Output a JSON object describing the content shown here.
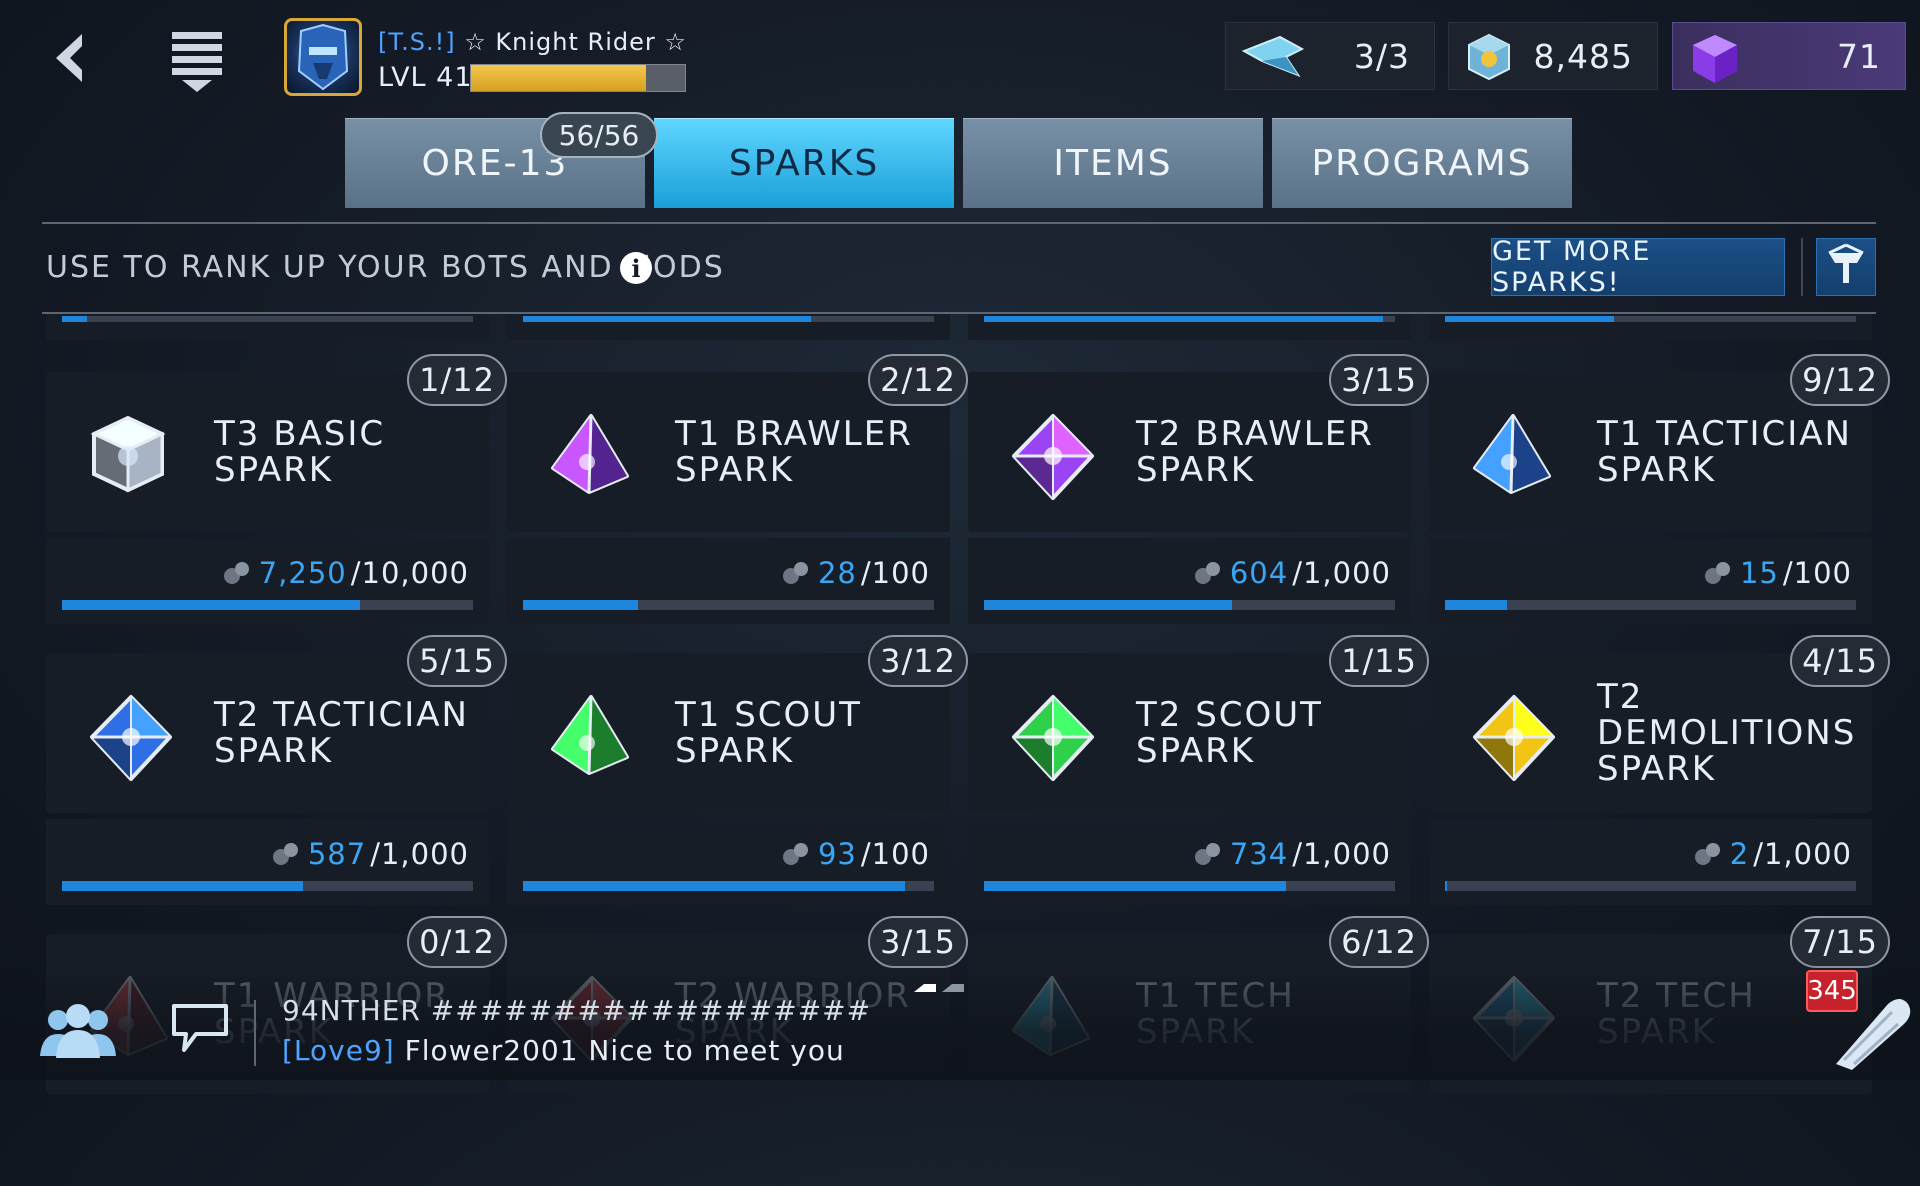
{
  "header": {
    "player_tag": "[T.S.!]",
    "player_name": " ☆ Knight Rider ☆",
    "level": "LVL 41",
    "xp_fraction": 0.82
  },
  "resources": {
    "energy": "3/3",
    "ore": "8,485",
    "gems": "71"
  },
  "tabs": [
    {
      "label": "ORE-13",
      "active": false
    },
    {
      "label": "SPARKS",
      "active": true
    },
    {
      "label": "ITEMS",
      "active": false
    },
    {
      "label": "PROGRAMS",
      "active": false
    }
  ],
  "ore_badge": "56/56",
  "subheader": {
    "text": "USE TO RANK UP YOUR BOTS AND MODS",
    "get_more_label": "GET MORE SPARKS!"
  },
  "partial_row_fills": [
    0.06,
    0.7,
    0.97,
    0.41
  ],
  "cards": [
    {
      "name": "T3 BASIC SPARK",
      "badge": "1/12",
      "current": "7,250",
      "total": "/10,000",
      "fill": 0.725,
      "gem_color": "#a8b4c4",
      "gem_icon": "cube-gem-icon"
    },
    {
      "name": "T1 BRAWLER SPARK",
      "badge": "2/12",
      "current": "28",
      "total": "/100",
      "fill": 0.28,
      "gem_color": "#8a3cf0",
      "gem_icon": "tetra-gem-icon"
    },
    {
      "name": "T2 BRAWLER SPARK",
      "badge": "3/15",
      "current": "604",
      "total": "/1,000",
      "fill": 0.604,
      "gem_color": "#9a44f4",
      "gem_icon": "octa-gem-icon"
    },
    {
      "name": "T1 TACTICIAN SPARK",
      "badge": "9/12",
      "current": "15",
      "total": "/100",
      "fill": 0.15,
      "gem_color": "#2f6fe6",
      "gem_icon": "tetra-gem-icon"
    },
    {
      "name": "T2 TACTICIAN SPARK",
      "badge": "5/15",
      "current": "587",
      "total": "/1,000",
      "fill": 0.587,
      "gem_color": "#2f6fe6",
      "gem_icon": "octa-gem-icon"
    },
    {
      "name": "T1 SCOUT SPARK",
      "badge": "3/12",
      "current": "93",
      "total": "/100",
      "fill": 0.93,
      "gem_color": "#2fd04a",
      "gem_icon": "tetra-gem-icon"
    },
    {
      "name": "T2 SCOUT SPARK",
      "badge": "1/15",
      "current": "734",
      "total": "/1,000",
      "fill": 0.734,
      "gem_color": "#2fd04a",
      "gem_icon": "octa-gem-icon"
    },
    {
      "name": "T2 DEMOLITIONS SPARK",
      "badge": "4/15",
      "current": "2",
      "total": "/1,000",
      "fill": 0.002,
      "gem_color": "#f2c414",
      "gem_icon": "octa-gem-icon"
    },
    {
      "name": "T1 WARRIOR SPARK",
      "badge": "0/12",
      "current": "",
      "total": "",
      "fill": 0,
      "gem_color": "#d63232",
      "gem_icon": "tetra-gem-icon"
    },
    {
      "name": "T2 WARRIOR SPARK",
      "badge": "3/15",
      "current": "",
      "total": "",
      "fill": 0,
      "gem_color": "#d63232",
      "gem_icon": "octa-gem-icon"
    },
    {
      "name": "T1 TECH SPARK",
      "badge": "6/12",
      "current": "",
      "total": "",
      "fill": 0,
      "gem_color": "#2a9ad0",
      "gem_icon": "tetra-gem-icon"
    },
    {
      "name": "T2 TECH SPARK",
      "badge": "7/15",
      "current": "",
      "total": "",
      "fill": 0,
      "gem_color": "#2a9ad0",
      "gem_icon": "octa-gem-icon"
    }
  ],
  "chat": {
    "line1": "94NTHER ##################",
    "line2_tag": "[Love9]",
    "line2_text": " Flower2001 Nice to meet you",
    "notification_count": "345"
  },
  "colors": {
    "accent_blue": "#1e86dc",
    "progress_text": "#3ba5f2",
    "xp_gold": "#e8b53a",
    "active_tab": "#3cc0f0"
  }
}
